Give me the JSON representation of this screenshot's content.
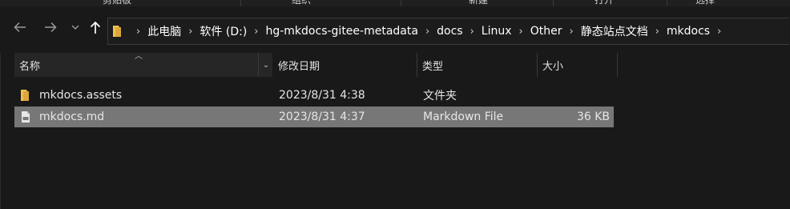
{
  "ribbon": {
    "groups": [
      "剪贴板",
      "组织",
      "新建",
      "打开",
      "选择"
    ]
  },
  "nav": {
    "back_icon": "arrow-left-icon",
    "forward_icon": "arrow-right-icon",
    "recent_icon": "chevron-down-icon",
    "up_icon": "arrow-up-icon"
  },
  "address": {
    "folder_icon": "folder-icon",
    "crumbs": [
      "此电脑",
      "软件 (D:)",
      "hg-mkdocs-gitee-metadata",
      "docs",
      "Linux",
      "Other",
      "静态站点文档",
      "mkdocs"
    ]
  },
  "columns": {
    "name": "名称",
    "date": "修改日期",
    "type": "类型",
    "size": "大小"
  },
  "files": [
    {
      "icon": "folder-icon",
      "name": "mkdocs.assets",
      "date": "2023/8/31 4:38",
      "type": "文件夹",
      "size": "",
      "selected": false
    },
    {
      "icon": "markdown-file-icon",
      "name": "mkdocs.md",
      "date": "2023/8/31 4:37",
      "type": "Markdown File",
      "size": "36 KB",
      "selected": true
    }
  ],
  "colors": {
    "background": "#191919",
    "selection": "#777777",
    "folder": "#f3c04f"
  }
}
